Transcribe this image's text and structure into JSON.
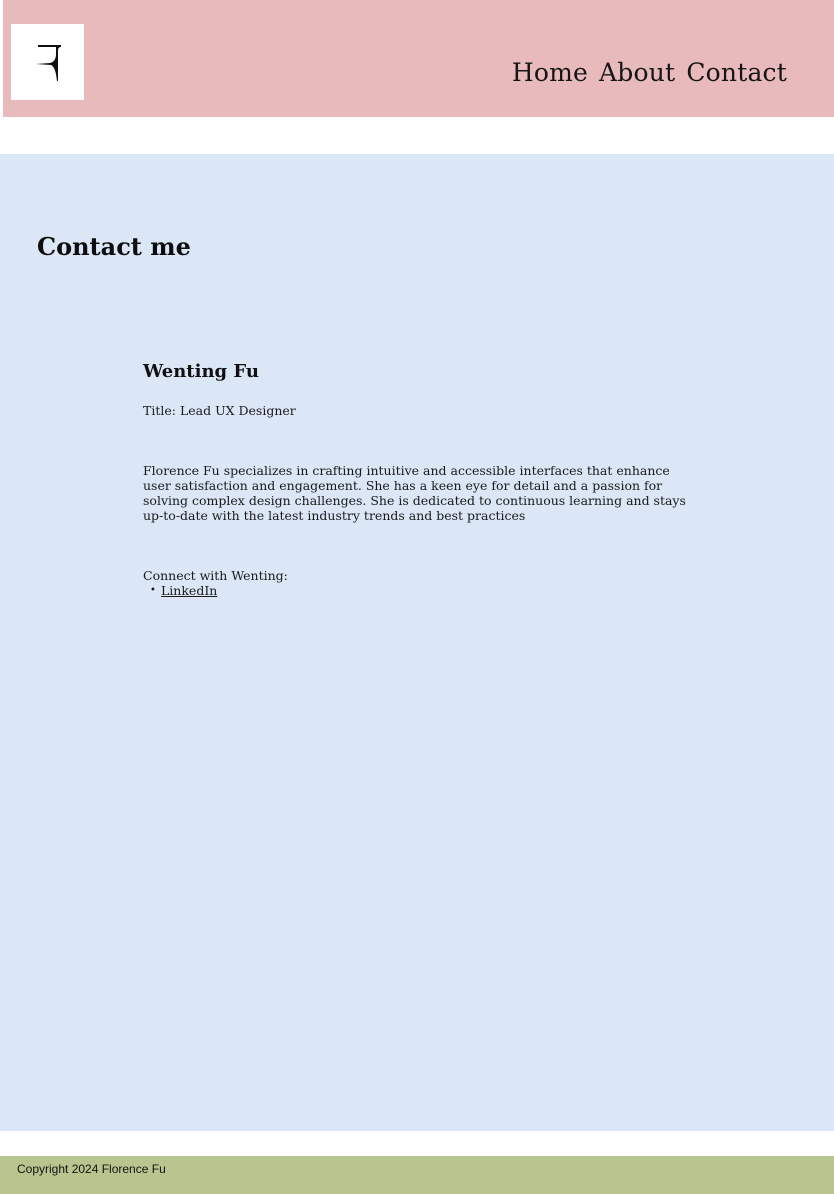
{
  "header": {
    "logo_icon": "letter-f-logo",
    "nav": {
      "home": "Home",
      "about": "About",
      "contact": "Contact"
    }
  },
  "main": {
    "title": "Contact me",
    "profile": {
      "name": "Wenting Fu",
      "title_label": "Title:",
      "title_value": "Lead UX Designer",
      "bio": "Florence Fu specializes in crafting intuitive and accessible interfaces that enhance user satisfaction and engagement. She has a keen eye for detail and a passion for solving complex design challenges. She is dedicated to continuous learning and stays up-to-date with the latest industry trends and best practices",
      "connect_label": "Connect with Wenting:",
      "links": [
        {
          "label": "LinkedIn"
        }
      ]
    }
  },
  "footer": {
    "copyright": "Copyright 2024 Florence Fu"
  },
  "colors": {
    "header_bg": "#e8babc",
    "main_bg": "#dbe6f6",
    "footer_bg": "#b8c58f"
  }
}
